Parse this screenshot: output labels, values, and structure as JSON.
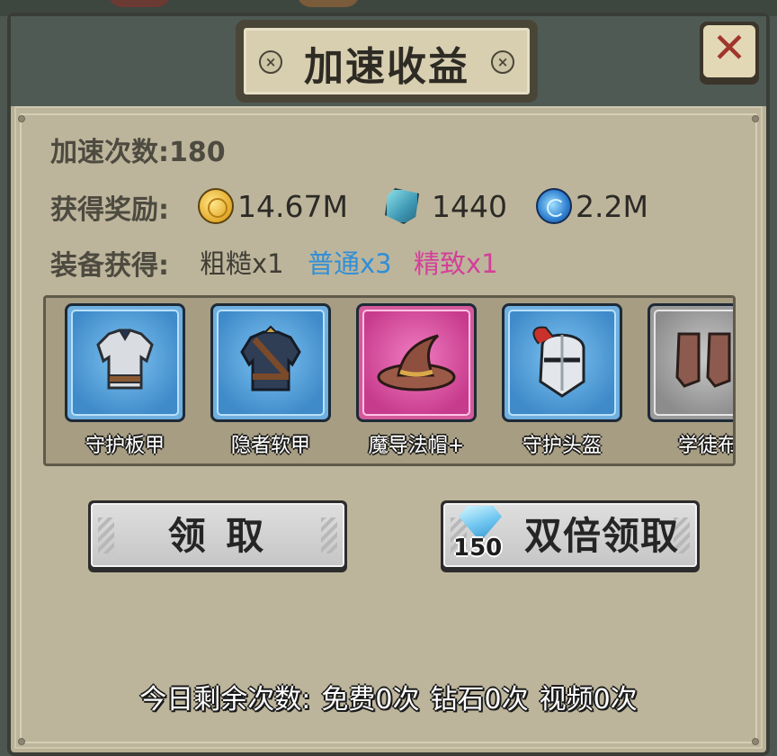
{
  "dialog": {
    "title": "加速收益",
    "close_label": "✕"
  },
  "accel": {
    "count_label": "加速次数:",
    "count_value": "180"
  },
  "rewards": {
    "label": "获得奖励:",
    "items": [
      {
        "icon": "gold-coin-icon",
        "value": "14.67M"
      },
      {
        "icon": "spirit-stone-icon",
        "value": "1440"
      },
      {
        "icon": "blue-orb-icon",
        "value": "2.2M"
      }
    ]
  },
  "equipment": {
    "label": "装备获得:",
    "tiers": [
      {
        "text": "粗糙x1",
        "color": "#3f3c34"
      },
      {
        "text": "普通x3",
        "color": "#2f8fd8"
      },
      {
        "text": "精致x1",
        "color": "#d43f9a"
      }
    ],
    "items": [
      {
        "name": "守护板甲",
        "rarity": "blue",
        "icon": "plate-armor-icon"
      },
      {
        "name": "隐者软甲",
        "rarity": "blue",
        "icon": "leather-armor-icon"
      },
      {
        "name": "魔导法帽+",
        "rarity": "pink",
        "icon": "wizard-hat-icon"
      },
      {
        "name": "守护头盔",
        "rarity": "blue",
        "icon": "knight-helmet-icon"
      },
      {
        "name": "学徒布",
        "rarity": "gray",
        "icon": "cloth-boots-icon"
      }
    ]
  },
  "buttons": {
    "claim": "领 取",
    "double_claim": "双倍领取",
    "double_cost": "150"
  },
  "footer": {
    "label": "今日剩余次数:",
    "free": "免费0次",
    "diamond": "钻石0次",
    "video": "视频0次"
  },
  "colors": {
    "panel": "#bdb59b",
    "blue_rarity": "#3f8ac9",
    "pink_rarity": "#c73b8c",
    "close_x": "#a0352b"
  }
}
